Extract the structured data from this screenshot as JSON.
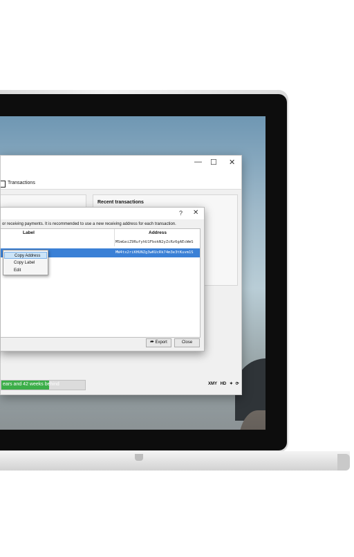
{
  "main_window": {
    "toolbar": {
      "transactions_label": "Transactions"
    },
    "recent_transactions_title": "Recent transactions",
    "sync_status": "ears and 42 weeks behind",
    "sync_progress": 0.57,
    "status_icons": {
      "currency": "XMY",
      "hd": "HD"
    }
  },
  "dialog": {
    "help_label": "?",
    "close_label": "✕",
    "description": "or receiving payments. It is recommended to use a new receiving address for each transaction.",
    "columns": {
      "label": "Label",
      "address": "Address"
    },
    "rows": [
      {
        "address": "MSmGeiZ9RufyhU1FbokN2yZcRz6gAEcWmS"
      },
      {
        "address": "MW4tx2riKHUNZg3wKUcRk74m3e3tKuvm1S"
      }
    ],
    "buttons": {
      "export": "Export",
      "close": "Close"
    }
  },
  "context_menu": {
    "items": [
      "Copy Address",
      "Copy Label",
      "Edit"
    ]
  },
  "window_controls": {
    "minimize": "—",
    "maximize": "☐",
    "close": "✕"
  },
  "colors": {
    "accent": "#3a80d6",
    "progress": "#3cae49"
  }
}
